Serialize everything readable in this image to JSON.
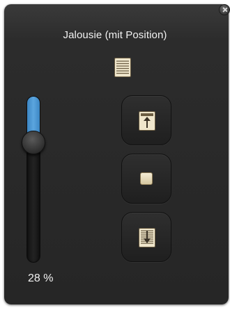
{
  "widget": {
    "title": "Jalousie (mit Position)",
    "position_value": "28 %",
    "position_percent": 28,
    "icons": {
      "header": "blind-icon",
      "up": "blind-up-arrow-icon",
      "stop": "stop-icon",
      "down": "blind-down-arrow-icon",
      "close": "close-icon"
    }
  },
  "colors": {
    "panel": "#2a2a2a",
    "slider_fill": "#4a96d2",
    "text": "#f2f2f2",
    "icon_fill": "#efe6cc"
  }
}
